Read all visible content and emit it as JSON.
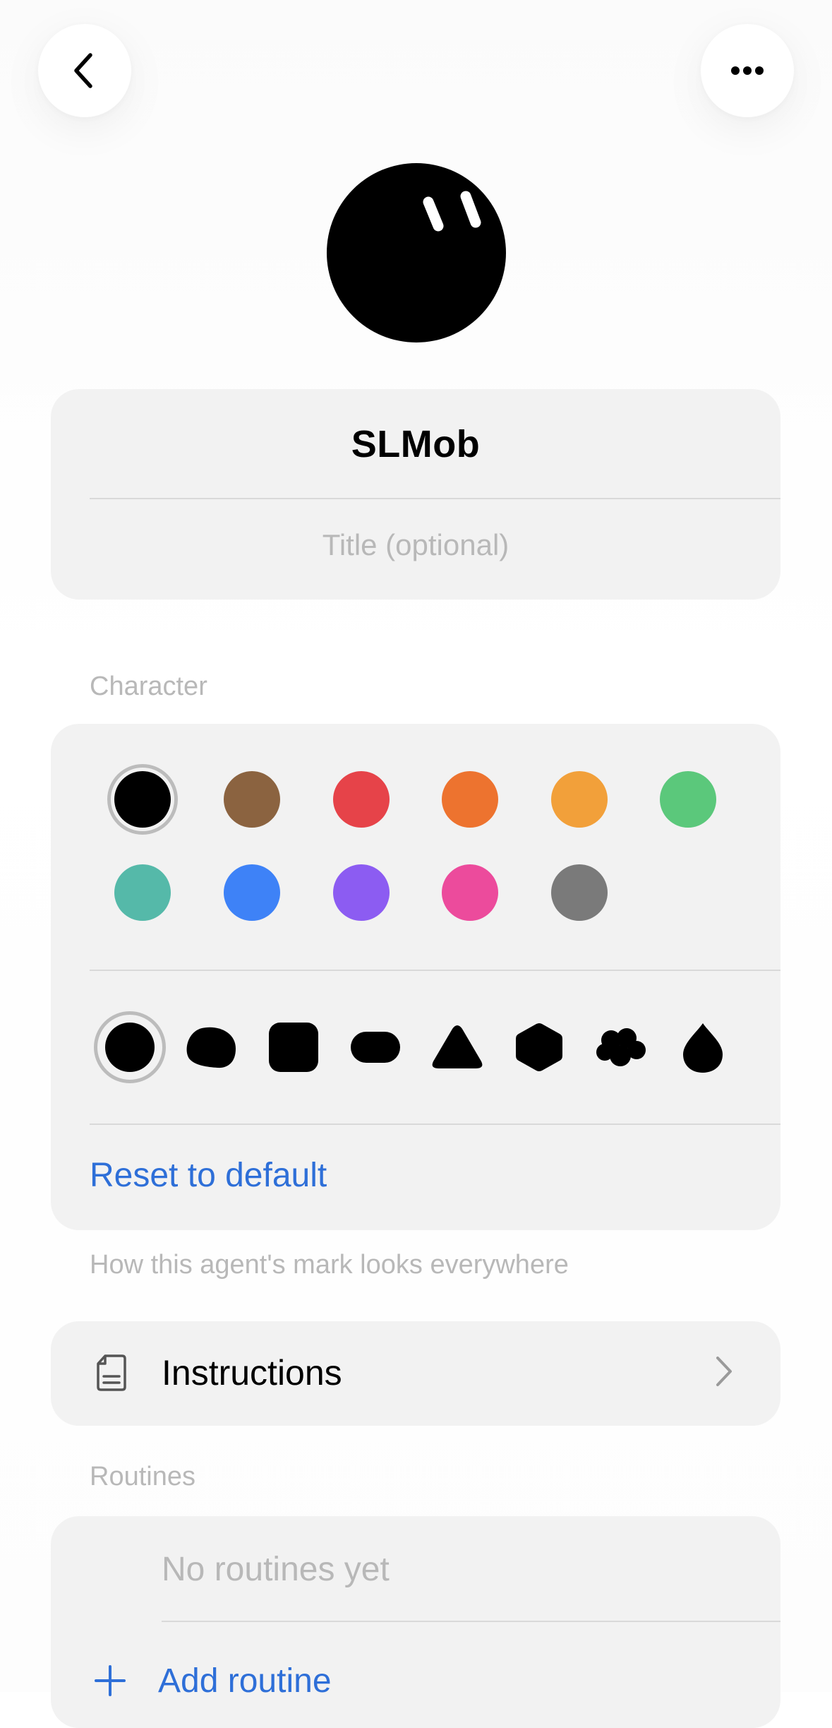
{
  "agent": {
    "name": "SLMob",
    "title_placeholder": "Title (optional)",
    "title_value": ""
  },
  "character": {
    "section_label": "Character",
    "colors": [
      {
        "name": "black",
        "hex": "#000000",
        "selected": true
      },
      {
        "name": "brown",
        "hex": "#8b6340"
      },
      {
        "name": "red",
        "hex": "#e64349"
      },
      {
        "name": "orange",
        "hex": "#ed732f"
      },
      {
        "name": "amber",
        "hex": "#f2a03a"
      },
      {
        "name": "green",
        "hex": "#5bc87b"
      },
      {
        "name": "teal",
        "hex": "#55b9a9"
      },
      {
        "name": "blue",
        "hex": "#3e82f7"
      },
      {
        "name": "purple",
        "hex": "#8c5cf2"
      },
      {
        "name": "pink",
        "hex": "#ec4b9c"
      },
      {
        "name": "gray",
        "hex": "#7a7a7a"
      }
    ],
    "shapes": [
      {
        "name": "circle",
        "selected": true
      },
      {
        "name": "blob"
      },
      {
        "name": "rounded-square"
      },
      {
        "name": "pill"
      },
      {
        "name": "triangle"
      },
      {
        "name": "hexagon"
      },
      {
        "name": "cloud"
      },
      {
        "name": "drop"
      }
    ],
    "reset_label": "Reset to default",
    "helper_text": "How this agent's mark looks everywhere"
  },
  "instructions": {
    "label": "Instructions",
    "icon": "document-icon"
  },
  "routines": {
    "section_label": "Routines",
    "empty_text": "No routines yet",
    "add_label": "Add routine"
  },
  "icons": {
    "back": "chevron-left-icon",
    "more": "ellipsis-icon"
  }
}
